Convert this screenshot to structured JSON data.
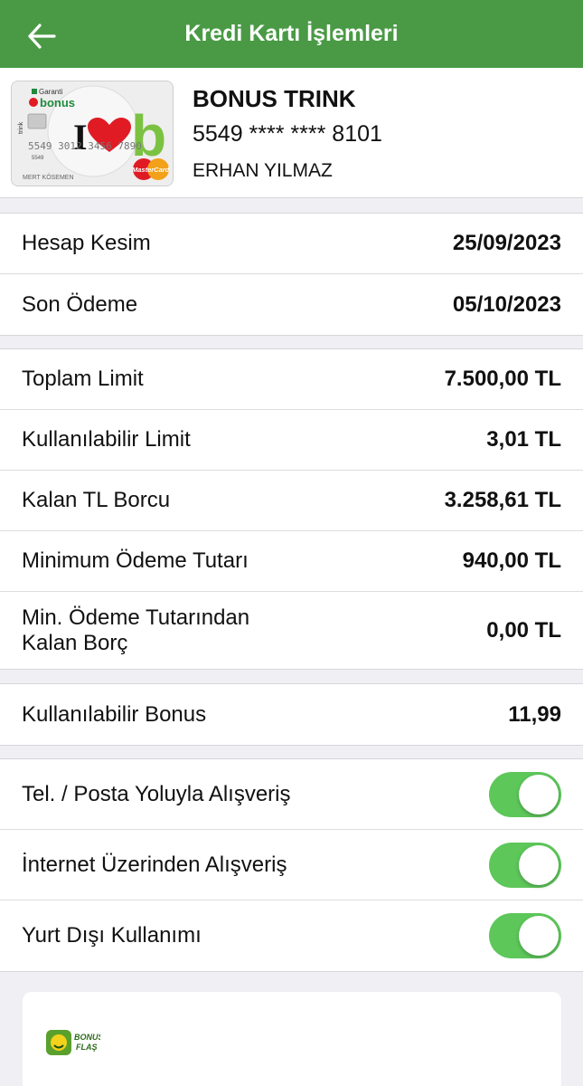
{
  "header": {
    "title": "Kredi Kartı İşlemleri",
    "back_icon": "arrow-left-icon",
    "background_color": "#4a9a45"
  },
  "card": {
    "name": "BONUS TRINK",
    "number": "5549 **** **** 8101",
    "holder": "ERHAN YILMAZ",
    "image": {
      "issuer": "Garanti",
      "brand": "bonus",
      "sub_brand": "trink",
      "printed_number": "5549 3012 3456 7890",
      "printed_name": "MERT KÖSEMEN",
      "network": "MasterCard"
    }
  },
  "dates": [
    {
      "label": "Hesap Kesim",
      "value": "25/09/2023"
    },
    {
      "label": "Son Ödeme",
      "value": "05/10/2023"
    }
  ],
  "limits": [
    {
      "label": "Toplam Limit",
      "value": "7.500,00 TL"
    },
    {
      "label": "Kullanılabilir Limit",
      "value": "3,01 TL"
    },
    {
      "label": "Kalan TL Borcu",
      "value": "3.258,61 TL"
    },
    {
      "label": "Minimum Ödeme Tutarı",
      "value": "940,00 TL"
    },
    {
      "label_line1": "Min. Ödeme Tutarından",
      "label_line2": "Kalan Borç",
      "value": "0,00 TL"
    }
  ],
  "bonus": {
    "label": "Kullanılabilir Bonus",
    "value": "11,99"
  },
  "toggles": [
    {
      "label": "Tel. / Posta Yoluyla Alışveriş",
      "on": true
    },
    {
      "label": "İnternet Üzerinden Alışveriş",
      "on": true
    },
    {
      "label": "Yurt Dışı Kullanımı",
      "on": true
    }
  ],
  "toggle_on_color": "#5dc75a",
  "promo": {
    "logo_line1": "BONUS",
    "logo_line2": "FLAŞ"
  }
}
